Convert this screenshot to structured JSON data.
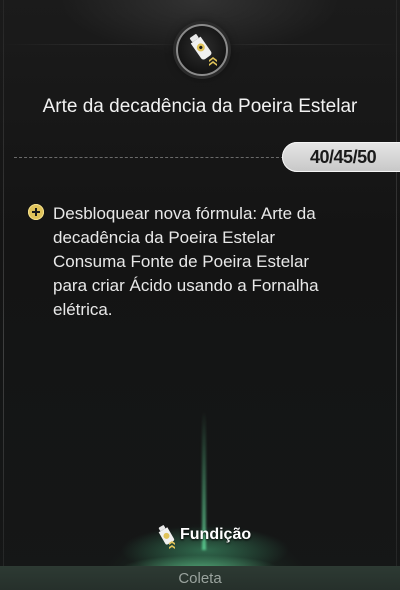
{
  "title": "Arte da decadência da Poeira Estelar",
  "level": {
    "current": "40",
    "sep1": "/",
    "mid": "45",
    "sep2": "/",
    "max": "50"
  },
  "description": [
    "Desbloquear nova fórmula: Arte da",
    "decadência da Poeira Estelar",
    "Consuma Fonte de Poeira Estelar",
    "para criar Ácido usando a Fornalha",
    "elétrica."
  ],
  "tabs": {
    "active": "Fundição",
    "next": "Coleta"
  },
  "icons": {
    "badge": "acid-bottle-icon",
    "rank": "rank-chevrons-icon",
    "bullet": "plus-circle-icon"
  },
  "colors": {
    "gold": "#e0c35a",
    "glow": "#6ef0aa"
  }
}
